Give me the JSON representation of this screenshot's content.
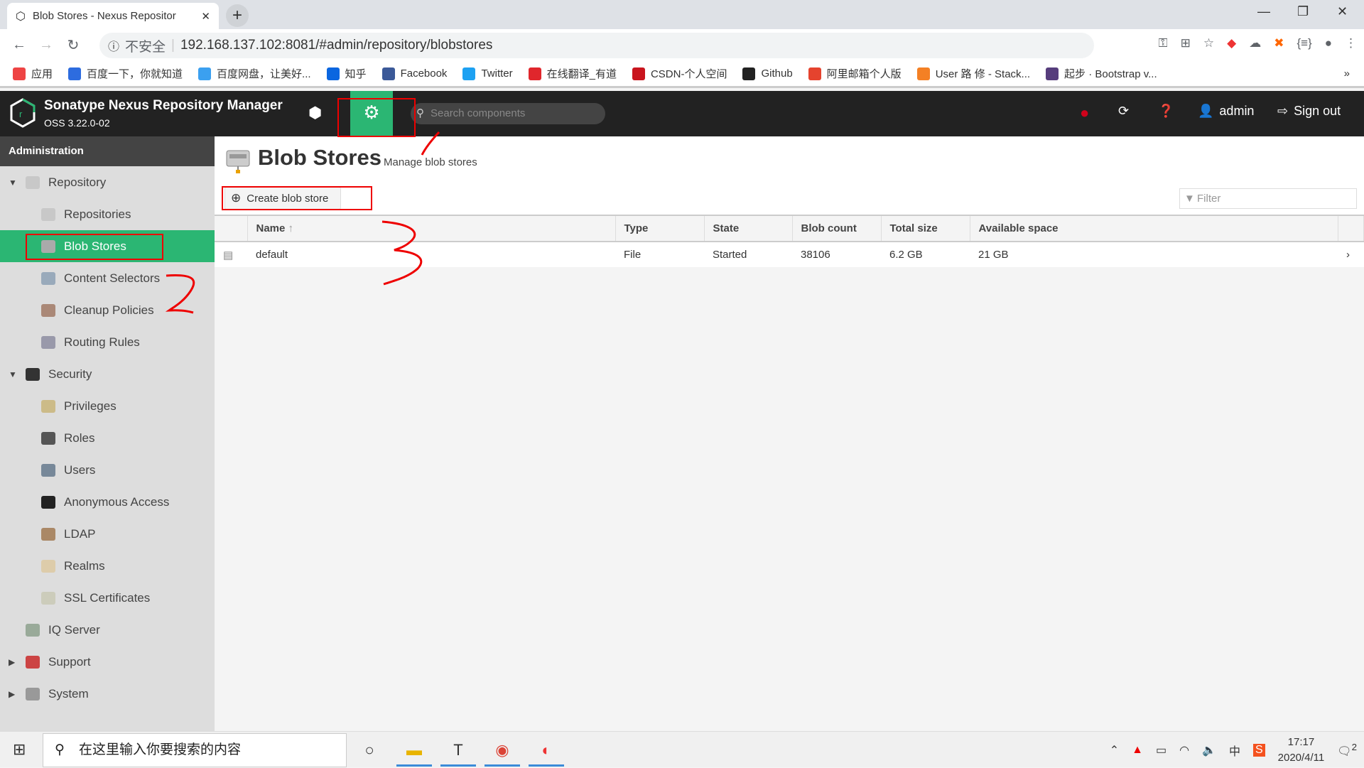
{
  "browser": {
    "tab_title": "Blob Stores - Nexus Repositor",
    "tab_close": "✕",
    "new_tab": "+",
    "url_security": "不安全",
    "url": "192.168.137.102:8081/#admin/repository/blobstores",
    "bookmarks": [
      {
        "label": "应用",
        "icon": "apps-grid-icon",
        "color": "#e44"
      },
      {
        "label": "百度一下，你就知道",
        "icon": "baidu-icon",
        "color": "#2d6cdf"
      },
      {
        "label": "百度网盘，让美好...",
        "icon": "baidu-pan-icon",
        "color": "#3ba0f0"
      },
      {
        "label": "知乎",
        "icon": "zhihu-icon",
        "color": "#0a66e0"
      },
      {
        "label": "Facebook",
        "icon": "facebook-icon",
        "color": "#3b5998"
      },
      {
        "label": "Twitter",
        "icon": "twitter-icon",
        "color": "#1da1f2"
      },
      {
        "label": "在线翻译_有道",
        "icon": "youdao-icon",
        "color": "#e0262c"
      },
      {
        "label": "CSDN-个人空间",
        "icon": "csdn-icon",
        "color": "#c9151e"
      },
      {
        "label": "Github",
        "icon": "github-icon",
        "color": "#222"
      },
      {
        "label": "阿里邮箱个人版",
        "icon": "aliyun-mail-icon",
        "color": "#e5432e"
      },
      {
        "label": "User 路 修 - Stack...",
        "icon": "stackoverflow-icon",
        "color": "#f48024"
      },
      {
        "label": "起步 · Bootstrap v...",
        "icon": "bootstrap-icon",
        "color": "#563d7c"
      }
    ],
    "bookmarks_more": "»"
  },
  "header": {
    "app_name": "Sonatype Nexus Repository Manager",
    "version": "OSS 3.22.0-02",
    "search_placeholder": "Search components",
    "user": "admin",
    "sign_out": "Sign out"
  },
  "sidebar": {
    "title": "Administration",
    "items": [
      {
        "label": "Repository",
        "level": 0,
        "expanded": true,
        "icon": "database-icon"
      },
      {
        "label": "Repositories",
        "level": 1,
        "icon": "database-icon"
      },
      {
        "label": "Blob Stores",
        "level": 1,
        "selected": true,
        "icon": "blob-store-icon"
      },
      {
        "label": "Content Selectors",
        "level": 1,
        "icon": "content-selector-icon"
      },
      {
        "label": "Cleanup Policies",
        "level": 1,
        "icon": "broom-icon"
      },
      {
        "label": "Routing Rules",
        "level": 1,
        "icon": "router-icon"
      },
      {
        "label": "Security",
        "level": 0,
        "expanded": true,
        "icon": "police-cap-icon"
      },
      {
        "label": "Privileges",
        "level": 1,
        "icon": "medal-icon"
      },
      {
        "label": "Roles",
        "level": 1,
        "icon": "officer-icon"
      },
      {
        "label": "Users",
        "level": 1,
        "icon": "users-icon"
      },
      {
        "label": "Anonymous Access",
        "level": 1,
        "icon": "person-icon"
      },
      {
        "label": "LDAP",
        "level": 1,
        "icon": "book-icon"
      },
      {
        "label": "Realms",
        "level": 1,
        "icon": "shield-icon"
      },
      {
        "label": "SSL Certificates",
        "level": 1,
        "icon": "certificate-icon"
      },
      {
        "label": "IQ Server",
        "level": 0,
        "icon": "iq-server-icon"
      },
      {
        "label": "Support",
        "level": 0,
        "expanded": false,
        "icon": "lifebuoy-icon"
      },
      {
        "label": "System",
        "level": 0,
        "expanded": false,
        "icon": "gear-icon"
      }
    ]
  },
  "main": {
    "title": "Blob Stores",
    "subtitle": "Manage blob stores",
    "create_button": "Create blob store",
    "filter_placeholder": "Filter",
    "columns": [
      "Name",
      "Type",
      "State",
      "Blob count",
      "Total size",
      "Available space"
    ],
    "rows": [
      {
        "name": "default",
        "type": "File",
        "state": "Started",
        "blob_count": "38106",
        "total_size": "6.2 GB",
        "available_space": "21 GB"
      }
    ]
  },
  "annotations": [
    "1",
    "2",
    "3"
  ],
  "taskbar": {
    "search_placeholder": "在这里输入你要搜索的内容",
    "time": "17:17",
    "date": "2020/4/11",
    "notifications": "2",
    "ime": "中"
  }
}
